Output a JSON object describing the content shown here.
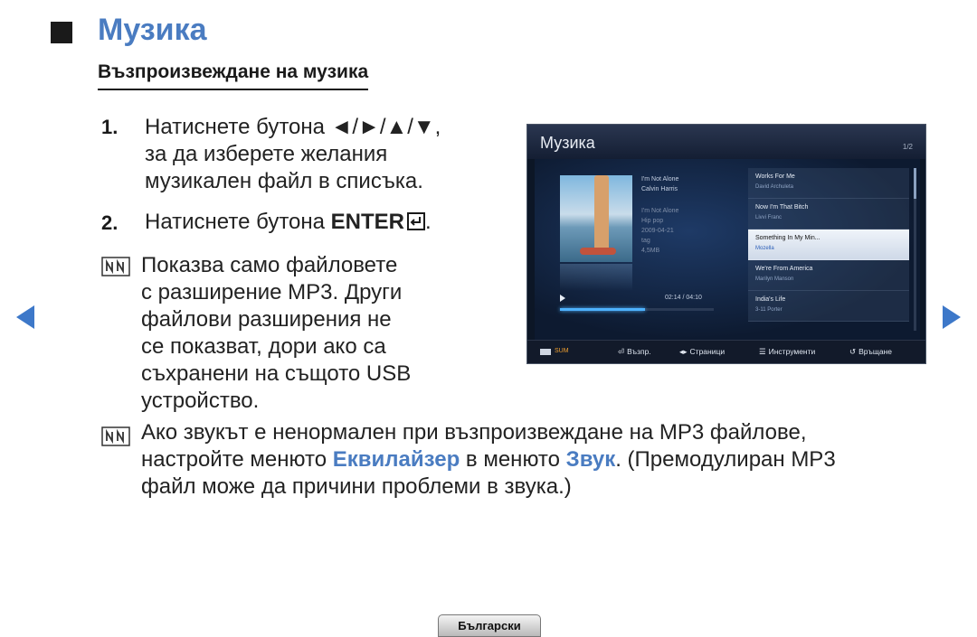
{
  "page": {
    "title": "Музика",
    "section_heading": "Възпроизвеждане на музика",
    "language_tab": "Български"
  },
  "steps": [
    {
      "number": "1.",
      "lines": [
        "Натиснете бутона ◄/►/▲/▼,",
        "за да изберете желания",
        "музикален файл в списъка."
      ]
    },
    {
      "number": "2.",
      "text": "Натиснете бутона ",
      "key": "ENTER",
      "after": "."
    }
  ],
  "notes": [
    {
      "lines": [
        "Показва само файловете",
        "с разширение MP3. Други",
        "файлови разширения не",
        "се показват, дори ако са",
        "съхранени на същото USB",
        "устройство."
      ]
    },
    {
      "line1": "Ако звукът е ненормален при възпроизвеждане на MP3 файлове,",
      "line2_a": "настройте менюто ",
      "line2_link1": "Еквилайзер",
      "line2_b": " в менюто ",
      "line2_link2": "Звук",
      "line2_c": ". (Премодулиран MP3",
      "line3": "файл може да причини проблеми в звука.)"
    }
  ],
  "tv": {
    "title": "Музика",
    "page_indicator": "1/2",
    "now_playing": {
      "song": "I'm Not Alone",
      "artist": "Calvin Harris",
      "album": "I'm Not Alone",
      "genre": "Hip pop",
      "date": "2009-04-21",
      "tag": "tag",
      "size": "4,5MB",
      "time": "02:14 / 04:10",
      "progress": 0.55
    },
    "playlist": [
      {
        "title": "Works For Me",
        "artist": "David Archuleta",
        "selected": false
      },
      {
        "title": "Now I'm That Bitch",
        "artist": "Livvi Franc",
        "selected": false
      },
      {
        "title": "Something In My Min...",
        "artist": "Mozella",
        "selected": true
      },
      {
        "title": "We're From America",
        "artist": "Marilyn Manson",
        "selected": false
      },
      {
        "title": "India's Life",
        "artist": "3-11 Porter",
        "selected": false
      }
    ],
    "footer": {
      "sum": "SUM",
      "play": "Възпр.",
      "pages": "Страници",
      "tools": "Инструменти",
      "return": "Връщане"
    }
  },
  "colors": {
    "title_blue": "#4a7cc1",
    "nav_arrow": "#3d78c9"
  }
}
